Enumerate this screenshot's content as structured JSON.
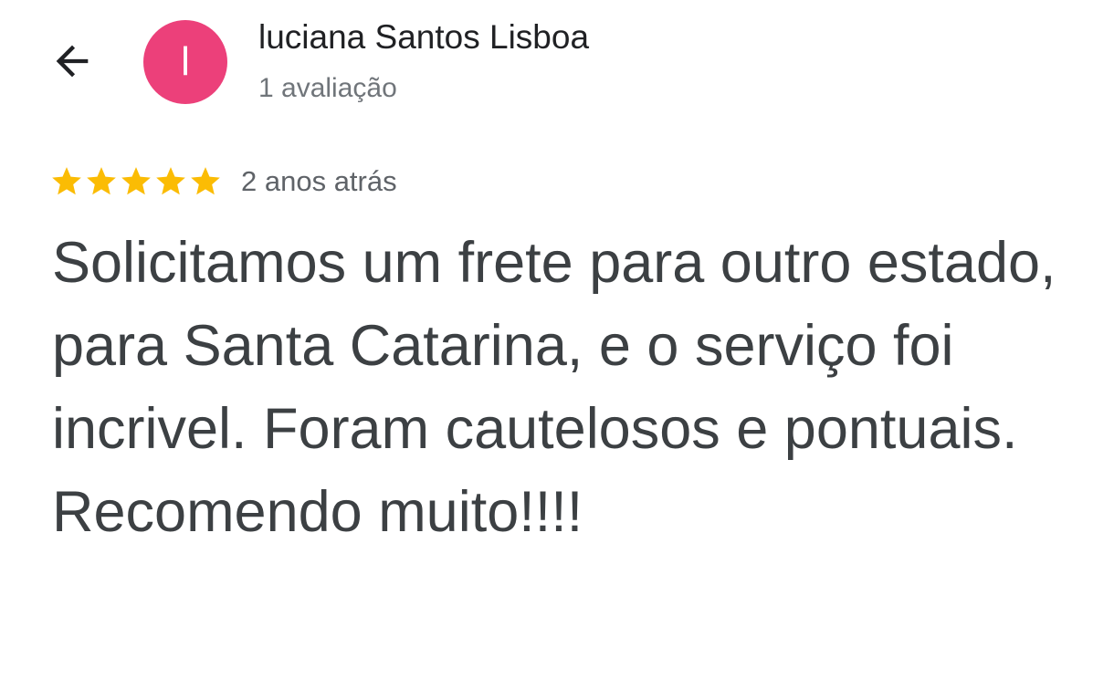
{
  "header": {
    "back_icon": "arrow-left-icon",
    "avatar": {
      "initial": "l",
      "color": "#ec407a"
    },
    "user_name": "luciana Santos Lisboa",
    "review_count": "1 avaliação"
  },
  "review": {
    "rating": 5,
    "rating_max": 5,
    "star_icon": "star-icon",
    "star_color": "#fbbc04",
    "time_ago": "2 anos atrás",
    "text": "Solicitamos um frete para outro estado, para Santa Catarina, e o serviço foi incrivel. Foram cautelosos e pontuais. Recomendo muito!!!!"
  }
}
